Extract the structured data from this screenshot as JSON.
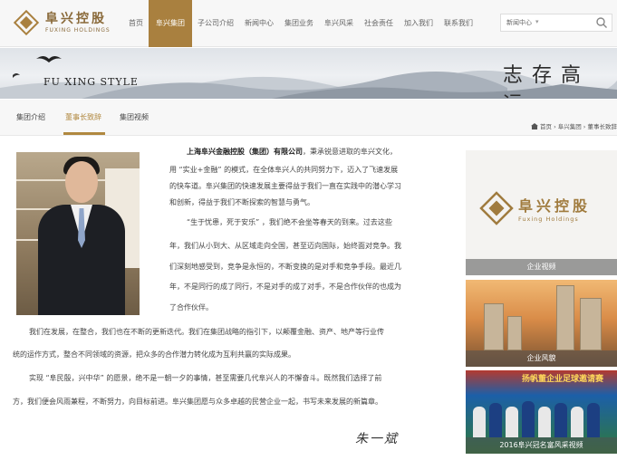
{
  "header": {
    "logo_cn": "阜兴控股",
    "logo_en": "FUXING HOLDINGS",
    "nav": [
      "首页",
      "阜兴集团",
      "子公司介绍",
      "新闻中心",
      "集团业务",
      "阜兴风采",
      "社会责任",
      "加入我们",
      "联系我们"
    ],
    "active_nav_index": 1,
    "search": {
      "value": "新闻中心",
      "icon": "search-icon",
      "dropdown_icon": "chevron-down-icon"
    }
  },
  "banner": {
    "style_text": "FU XING STYLE",
    "calligraphy": "志存高远"
  },
  "subnav": {
    "tabs": [
      "集团介绍",
      "董事长致辞",
      "集团视频"
    ],
    "active_tab_index": 1,
    "breadcrumb": "首页 › 阜兴集团 › 董事长致辞"
  },
  "speech": {
    "company": "上海阜兴金融控股（集团）有限公司",
    "lines": [
      "，秉承锐意进取的阜兴文化，",
      "用 “实业+金融” 的模式，在全体阜兴人的共同努力下，迈入了飞速发展",
      "的快车道。阜兴集团的快速发展主要得益于我们一直在实践中的潜心学习",
      "和创新，得益于我们不断探索的智慧与勇气。",
      "“生于忧患，死于安乐” ，我们绝不会坐等春天的到来。过去这些",
      "年，我们从小到大、从区域走向全国，甚至迈向国际，始终面对竞争。我",
      "们深刻地感受到，竞争是永恒的，不断变换的是对手和竞争手段。最近几",
      "年，不是同行的成了同行，不是对手的成了对手，不是合作伙伴的也成为",
      "了合作伙伴。",
      "我们在发展，在整合，我们也在不断的更新迭代。我们在集团战略的指引下，以颠覆金融、资产、地产等行业传",
      "统的运作方式，整合不同领域的资源，把众多的合作潜力转化成为互利共赢的实际成果。",
      "实现 “阜民殷，兴中华” 的愿景，绝不是一朝一夕的事情，甚至需要几代阜兴人的不懈奋斗。既然我们选择了前",
      "方，我们便会风雨兼程，不断努力，向目标前进。阜兴集团愿与众多卓越的民营企业一起，书写未来发展的新篇章。"
    ],
    "signature": "朱一斌"
  },
  "sidebar": {
    "card1_logo_cn": "阜兴控股",
    "card1_logo_en": "Fuxing Holdings",
    "card1_caption": "企业视频",
    "card2_caption": "企业风貌",
    "card3_banner": "扬帆董企业足球邀请赛",
    "card3_caption": "2016阜兴冠名富风采视频"
  },
  "colors": {
    "accent": "#a9803f",
    "text": "#444444"
  }
}
